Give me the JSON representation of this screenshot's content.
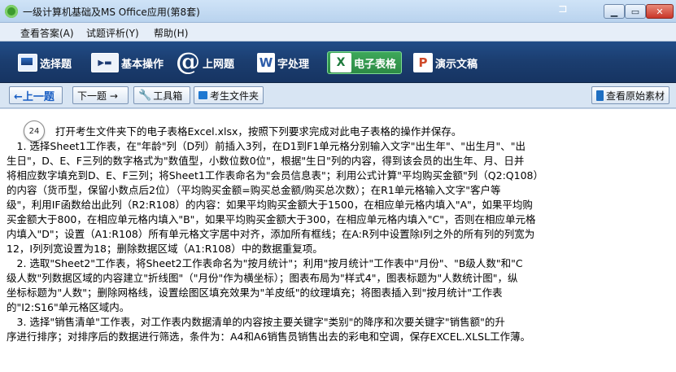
{
  "window": {
    "title": "一级计算机基础及MS Office应用(第8套)",
    "pin_glyph": "⊐",
    "controls": {
      "minimize": "▁",
      "maximize": "▭",
      "close": "✕"
    }
  },
  "menubar": [
    "查看答案(A)",
    "试题评析(Y)",
    "帮助(H)"
  ],
  "toolbar": {
    "tabs": [
      {
        "label": "选择题",
        "icon": "choice-icon"
      },
      {
        "label": "基本操作",
        "icon": "basic-ops-icon",
        "icon_text": "▶▬"
      },
      {
        "label": "上网题",
        "icon": "internet-icon",
        "icon_text": "@"
      },
      {
        "label": "字处理",
        "icon": "word-icon",
        "icon_text": "W"
      },
      {
        "label": "电子表格",
        "icon": "excel-icon",
        "icon_text": "X"
      },
      {
        "label": "演示文稿",
        "icon": "ppt-icon",
        "icon_text": "P"
      }
    ],
    "active_tab": "电子表格",
    "active_color": "#2d8a45"
  },
  "nav": {
    "prev": "←上一题",
    "next": "下一题 →",
    "toolbox_icon": "🔧",
    "toolbox": "工具箱",
    "folder": "考生文件夹",
    "view_original": "查看原始素材"
  },
  "question": {
    "number": "24",
    "lines": [
      "打开考生文件夹下的电子表格Excel.xlsx，按照下列要求完成对此电子表格的操作并保存。",
      "　1. 选择Sheet1工作表，在\"年龄\"列（D列）前插入3列，在D1到F1单元格分别输入文字\"出生年\"、\"出生月\"、\"出",
      "生日\"，D、E、F三列的数字格式为\"数值型，小数位数0位\"，根据\"生日\"列的内容，得到该会员的出生年、月、日并",
      "将相应数字填充到D、E、F三列；将Sheet1工作表命名为\"会员信息表\"；利用公式计算\"平均购买金额\"列（Q2:Q108）",
      "的内容（货币型，保留小数点后2位）（平均购买金额=购买总金额/购买总次数）；在R1单元格输入文字\"客户等",
      "级\"，利用IF函数给出此列（R2:R108）的内容：如果平均购买金额大于1500，在相应单元格内填入\"A\"，如果平均购",
      "买金额大于800，在相应单元格内填入\"B\"，如果平均购买金额大于300，在相应单元格内填入\"C\"，否则在相应单元格",
      "内填入\"D\"；设置（A1:R108）所有单元格文字居中对齐，添加所有框线；在A:R列中设置除I列之外的所有列的列宽为",
      "12，I列列宽设置为18；删除数据区域（A1:R108）中的数据重复项。",
      "　2. 选取\"Sheet2\"工作表，将Sheet2工作表命名为\"按月统计\"；利用\"按月统计\"工作表中\"月份\"、\"B级人数\"和\"C",
      "级人数\"列数据区域的内容建立\"折线图\"（\"月份\"作为横坐标）；图表布局为\"样式4\"，图表标题为\"人数统计图\"，纵",
      "坐标标题为\"人数\"；删除网格线，设置绘图区填充效果为\"羊皮纸\"的纹理填充；将图表插入到\"按月统计\"工作表",
      "的\"I2:S16\"单元格区域内。",
      "　3. 选择\"销售清单\"工作表，对工作表内数据清单的内容按主要关键字\"类别\"的降序和次要关键字\"销售额\"的升",
      "序进行排序；对排序后的数据进行筛选，条件为：A4和A6销售员销售出去的彩电和空调，保存EXCEL.XLSL工作薄。"
    ]
  }
}
